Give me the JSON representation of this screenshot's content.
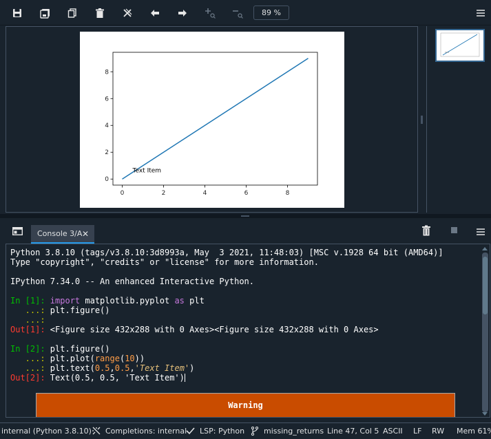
{
  "toolbar": {
    "icons": [
      "save-icon",
      "save-all-icon",
      "copy-icon",
      "delete-icon",
      "close-all-icon",
      "previous-icon",
      "next-icon",
      "zoom-in-icon",
      "zoom-out-icon"
    ],
    "zoom_value": "89 %"
  },
  "chart_data": {
    "type": "line",
    "x": [
      0,
      1,
      2,
      3,
      4,
      5,
      6,
      7,
      8,
      9
    ],
    "series": [
      {
        "values": [
          0,
          1,
          2,
          3,
          4,
          5,
          6,
          7,
          8,
          9
        ],
        "color": "#1f77b4"
      }
    ],
    "xticks": [
      "0",
      "2",
      "4",
      "6",
      "8"
    ],
    "yticks": [
      "0",
      "2",
      "4",
      "6",
      "8"
    ],
    "xlim": [
      -0.45,
      9.45
    ],
    "ylim": [
      -0.45,
      9.45
    ],
    "annotations": [
      {
        "text": "Text Item",
        "x": 0.5,
        "y": 0.5
      }
    ],
    "grid": false
  },
  "console_header": {
    "tab_label": "Console 3/A",
    "close_glyph": "✕"
  },
  "console": {
    "lines": [
      [
        {
          "t": "Python 3.8.10 (tags/v3.8.10:3d8993a, May  3 2021, 11:48:03) [MSC v.1928 64 bit (AMD64)]",
          "c": ""
        }
      ],
      [
        {
          "t": "Type \"copyright\", \"credits\" or \"license\" for more information.",
          "c": ""
        }
      ],
      [
        {
          "t": "",
          "c": ""
        }
      ],
      [
        {
          "t": "IPython 7.34.0 -- An enhanced Interactive Python.",
          "c": ""
        }
      ],
      [
        {
          "t": "",
          "c": ""
        }
      ],
      [
        {
          "t": "In [1]: ",
          "c": "c-prompt-in"
        },
        {
          "t": "import",
          "c": "c-kw"
        },
        {
          "t": " matplotlib.pyplot ",
          "c": ""
        },
        {
          "t": "as",
          "c": "c-kw"
        },
        {
          "t": " plt",
          "c": ""
        }
      ],
      [
        {
          "t": "   ...: ",
          "c": "c-prompt-cont"
        },
        {
          "t": "plt.figure()",
          "c": ""
        }
      ],
      [
        {
          "t": "   ...: ",
          "c": "c-prompt-cont"
        }
      ],
      [
        {
          "t": "Out[1]: ",
          "c": "c-prompt-out"
        },
        {
          "t": "<Figure size 432x288 with 0 Axes><Figure size 432x288 with 0 Axes>",
          "c": ""
        }
      ],
      [
        {
          "t": "",
          "c": ""
        }
      ],
      [
        {
          "t": "In [2]: ",
          "c": "c-prompt-in"
        },
        {
          "t": "plt.figure()",
          "c": ""
        }
      ],
      [
        {
          "t": "   ...: ",
          "c": "c-prompt-cont"
        },
        {
          "t": "plt.plot(",
          "c": ""
        },
        {
          "t": "range",
          "c": "c-num"
        },
        {
          "t": "(",
          "c": ""
        },
        {
          "t": "10",
          "c": "c-num"
        },
        {
          "t": "))",
          "c": ""
        }
      ],
      [
        {
          "t": "   ...: ",
          "c": "c-prompt-cont"
        },
        {
          "t": "plt.text(",
          "c": ""
        },
        {
          "t": "0.5",
          "c": "c-num"
        },
        {
          "t": ",",
          "c": ""
        },
        {
          "t": "0.5",
          "c": "c-num"
        },
        {
          "t": ",",
          "c": ""
        },
        {
          "t": "'Text Item'",
          "c": "c-str"
        },
        {
          "t": ")",
          "c": ""
        }
      ],
      [
        {
          "t": "Out[2]: ",
          "c": "c-prompt-out"
        },
        {
          "t": "Text(0.5, 0.5, 'Text Item')",
          "c": ""
        }
      ]
    ],
    "warning_title": "Warning"
  },
  "statusbar": {
    "interpreter": "internal (Python 3.8.10)",
    "completions": "Completions: internal",
    "lsp": "LSP: Python",
    "branch": "missing_returns",
    "position": "Line 47, Col 5",
    "encoding": "ASCII",
    "eol": "LF",
    "permissions": "RW",
    "memory": "Mem 61%"
  }
}
